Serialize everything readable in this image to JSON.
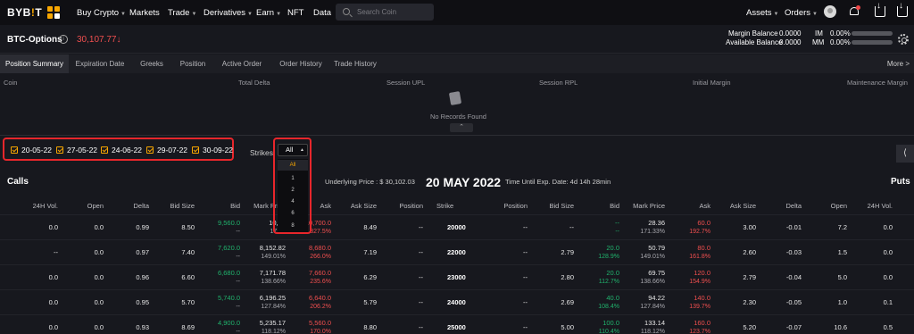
{
  "nav": {
    "logo_a": "BYB",
    "logo_b": "!",
    "logo_c": "T",
    "items": [
      "Buy Crypto",
      "Markets",
      "Trade",
      "Derivatives",
      "Earn",
      "NFT",
      "Data"
    ],
    "search_placeholder": "Search Coin",
    "assets": "Assets",
    "orders": "Orders"
  },
  "header": {
    "symbol": "BTC-Options",
    "price": "30,107.77",
    "price_arrow": "↓",
    "margin_balance_label": "Margin Balance",
    "margin_balance_value": "0.0000",
    "available_balance_label": "Available Balance",
    "available_balance_value": "0.0000",
    "im_label": "IM",
    "im_value": "0.00%",
    "mm_label": "MM",
    "mm_value": "0.00%"
  },
  "tabs": [
    "Position Summary",
    "Expiration Date",
    "Greeks",
    "Position",
    "Active Order",
    "Order History",
    "Trade History"
  ],
  "more_label": "More >",
  "position_table": {
    "columns": [
      "Coin",
      "Total Delta",
      "Session UPL",
      "Session RPL",
      "Initial Margin",
      "Maintenance Margin"
    ],
    "empty_text": "No Records Found"
  },
  "expiry_dates": [
    "20-05-22",
    "27-05-22",
    "24-06-22",
    "29-07-22",
    "30-09-22"
  ],
  "strikes": {
    "label": "Strikes",
    "selected": "All",
    "options": [
      "All",
      "1",
      "2",
      "4",
      "6",
      "8"
    ]
  },
  "chain": {
    "calls_label": "Calls",
    "puts_label": "Puts",
    "underlying": "Underlying Price : $ 30,102.03",
    "expiry_title": "20 MAY 2022",
    "time_until": "Time Until Exp. Date:  4d 14h 28min",
    "columns": [
      "24H Vol.",
      "Open",
      "Delta",
      "Bid Size",
      "Bid",
      "Mark Price",
      "Ask",
      "Ask Size",
      "Position",
      "Strike",
      "Position",
      "Bid Size",
      "Bid",
      "Mark Price",
      "Ask",
      "Ask Size",
      "Delta",
      "Open",
      "24H Vol."
    ],
    "rows": [
      {
        "c_vol": "0.0",
        "c_open": "0.0",
        "c_delta": "0.99",
        "c_bidsize": "8.50",
        "c_bid": "9,560.0",
        "c_bid_iv": "--",
        "c_mark": "10,13",
        "c_mark_iv": "171.3",
        "c_ask": "10,700.0",
        "c_ask_iv": "327.5%",
        "c_asksize": "8.49",
        "c_pos": "--",
        "strike": "20000",
        "p_pos": "--",
        "p_bidsize": "--",
        "p_bid": "--",
        "p_bid_iv": "--",
        "p_mark": "28.36",
        "p_mark_iv": "171.33%",
        "p_ask": "60.0",
        "p_ask_iv": "192.7%",
        "p_asksize": "3.00",
        "p_delta": "-0.01",
        "p_open": "7.2",
        "p_vol": "0.0"
      },
      {
        "c_vol": "--",
        "c_open": "0.0",
        "c_delta": "0.97",
        "c_bidsize": "7.40",
        "c_bid": "7,620.0",
        "c_bid_iv": "--",
        "c_mark": "8,152.82",
        "c_mark_iv": "149.01%",
        "c_ask": "8,680.0",
        "c_ask_iv": "266.0%",
        "c_asksize": "7.19",
        "c_pos": "--",
        "strike": "22000",
        "p_pos": "--",
        "p_bidsize": "2.79",
        "p_bid": "20.0",
        "p_bid_iv": "128.9%",
        "p_mark": "50.79",
        "p_mark_iv": "149.01%",
        "p_ask": "80.0",
        "p_ask_iv": "161.8%",
        "p_asksize": "2.60",
        "p_delta": "-0.03",
        "p_open": "1.5",
        "p_vol": "0.0"
      },
      {
        "c_vol": "0.0",
        "c_open": "0.0",
        "c_delta": "0.96",
        "c_bidsize": "6.60",
        "c_bid": "6,680.0",
        "c_bid_iv": "--",
        "c_mark": "7,171.78",
        "c_mark_iv": "138.66%",
        "c_ask": "7,660.0",
        "c_ask_iv": "235.6%",
        "c_asksize": "6.29",
        "c_pos": "--",
        "strike": "23000",
        "p_pos": "--",
        "p_bidsize": "2.80",
        "p_bid": "20.0",
        "p_bid_iv": "112.7%",
        "p_mark": "69.75",
        "p_mark_iv": "138.66%",
        "p_ask": "120.0",
        "p_ask_iv": "154.9%",
        "p_asksize": "2.79",
        "p_delta": "-0.04",
        "p_open": "5.0",
        "p_vol": "0.0"
      },
      {
        "c_vol": "0.0",
        "c_open": "0.0",
        "c_delta": "0.95",
        "c_bidsize": "5.70",
        "c_bid": "5,740.0",
        "c_bid_iv": "--",
        "c_mark": "6,196.25",
        "c_mark_iv": "127.84%",
        "c_ask": "6,640.0",
        "c_ask_iv": "206.2%",
        "c_asksize": "5.79",
        "c_pos": "--",
        "strike": "24000",
        "p_pos": "--",
        "p_bidsize": "2.69",
        "p_bid": "40.0",
        "p_bid_iv": "108.4%",
        "p_mark": "94.22",
        "p_mark_iv": "127.84%",
        "p_ask": "140.0",
        "p_ask_iv": "139.7%",
        "p_asksize": "2.30",
        "p_delta": "-0.05",
        "p_open": "1.0",
        "p_vol": "0.1"
      },
      {
        "c_vol": "0.0",
        "c_open": "0.0",
        "c_delta": "0.93",
        "c_bidsize": "8.69",
        "c_bid": "4,900.0",
        "c_bid_iv": "--",
        "c_mark": "5,235.17",
        "c_mark_iv": "118.12%",
        "c_ask": "5,560.0",
        "c_ask_iv": "170.0%",
        "c_asksize": "8.80",
        "c_pos": "--",
        "strike": "25000",
        "p_pos": "--",
        "p_bidsize": "5.00",
        "p_bid": "100.0",
        "p_bid_iv": "110.4%",
        "p_mark": "133.14",
        "p_mark_iv": "118.12%",
        "p_ask": "160.0",
        "p_ask_iv": "123.7%",
        "p_asksize": "5.20",
        "p_delta": "-0.07",
        "p_open": "10.6",
        "p_vol": "0.5"
      }
    ]
  }
}
